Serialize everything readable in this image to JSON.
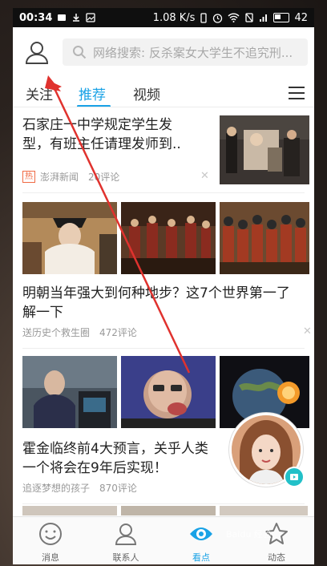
{
  "status_bar": {
    "time": "00:34",
    "network_speed": "1.08 K/s",
    "battery": "42"
  },
  "header": {
    "search_placeholder": "网络搜索: 反杀案女大学生不追究刑..."
  },
  "tabs": [
    {
      "label": "关注",
      "active": false
    },
    {
      "label": "推荐",
      "active": true
    },
    {
      "label": "视频",
      "active": false
    }
  ],
  "feed": [
    {
      "title_line1": "石家庄一中学规定学生发",
      "title_line2": "型，有班主任请理发师到..",
      "badge": "热",
      "source": "澎湃新闻",
      "comments": "20评论"
    },
    {
      "title_line1": "明朝当年强大到何种地步？这7个世界第一了",
      "title_line2": "解一下",
      "source": "送历史个救生圈",
      "comments": "472评论"
    },
    {
      "title_line1": "霍金临终前4大预言，关乎人类",
      "title_line2": "一个将会在9年后实现！",
      "source": "追逐梦想的孩子",
      "comments": "870评论"
    }
  ],
  "bottom_nav": [
    {
      "label": "消息",
      "icon": "smile-icon",
      "active": false
    },
    {
      "label": "联系人",
      "icon": "person-icon",
      "active": false
    },
    {
      "label": "看点",
      "icon": "eye-icon",
      "active": true
    },
    {
      "label": "动态",
      "icon": "star-icon",
      "active": false
    }
  ],
  "colors": {
    "accent": "#19a2e6",
    "hot": "#f06a43",
    "annotation": "#e0322e"
  }
}
